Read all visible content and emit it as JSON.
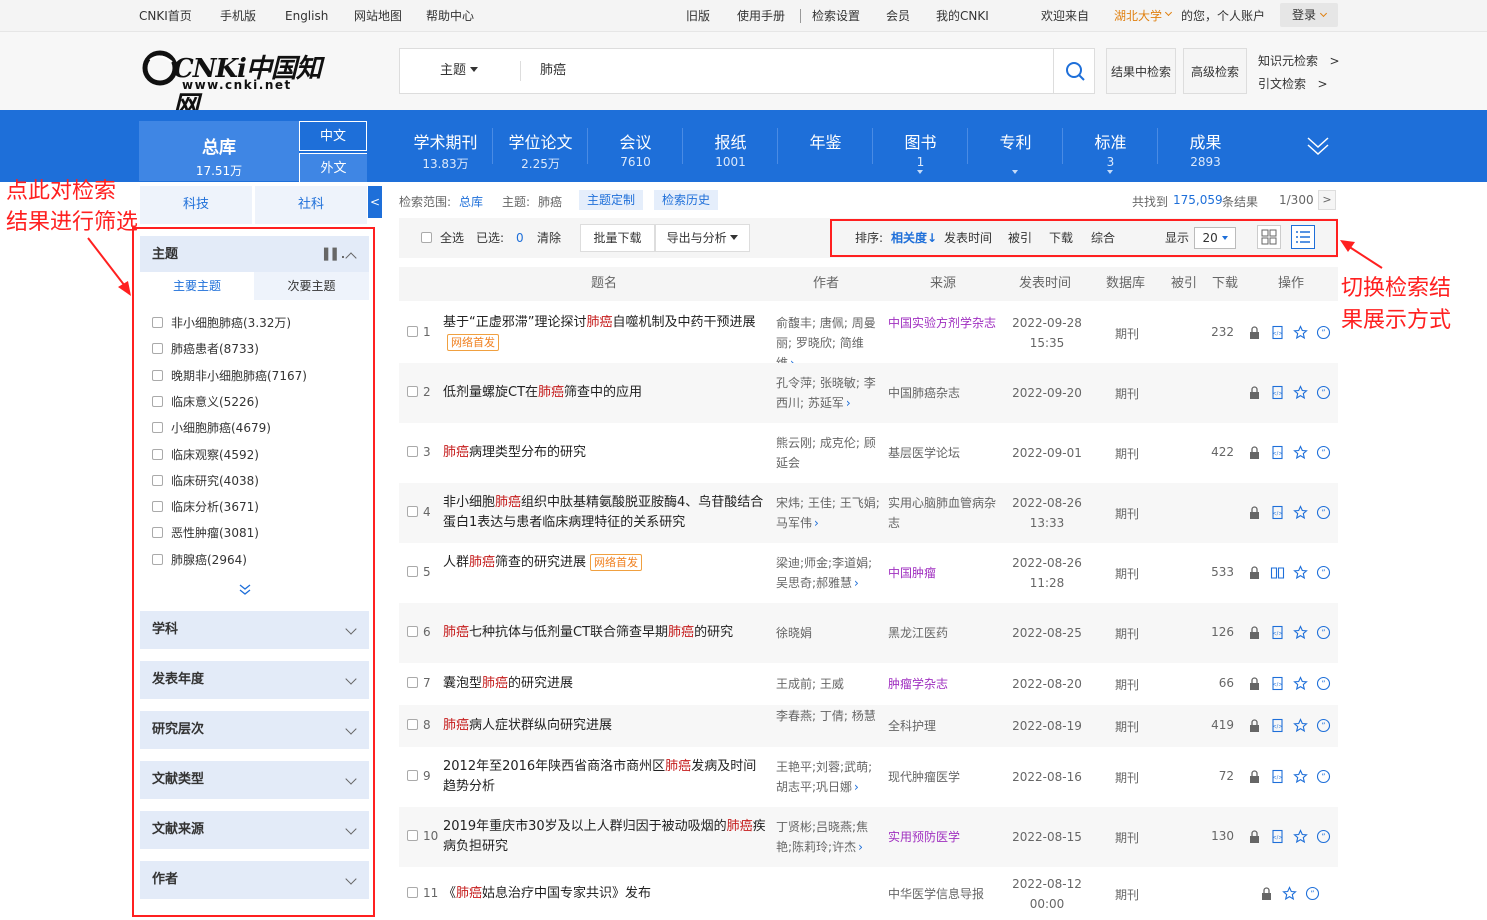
{
  "topbar": {
    "left_links": [
      "CNKI首页",
      "手机版",
      "English",
      "网站地图",
      "帮助中心"
    ],
    "right_links": [
      "旧版",
      "使用手册",
      "检索设置",
      "会员",
      "我的CNKI"
    ],
    "welcome": "欢迎来自",
    "institution": "湖北大学",
    "greeting": "的您，",
    "personal_account": "个人账户",
    "login": "登录"
  },
  "header": {
    "logo_text": "CNKi中国知网",
    "logo_url": "www.cnki.net",
    "search_type": "主题",
    "search_value": "肺癌",
    "btn_in_results": "结果中检索",
    "btn_advanced": "高级检索",
    "link_knowledge": "知识元检索",
    "link_citation": "引文检索"
  },
  "nav": {
    "zongku": {
      "label": "总库",
      "count": "17.51万"
    },
    "lang_cn": "中文",
    "lang_foreign": "外文",
    "items": [
      {
        "label": "学术期刊",
        "count": "13.83万",
        "caret": false
      },
      {
        "label": "学位论文",
        "count": "2.25万",
        "caret": false
      },
      {
        "label": "会议",
        "count": "7610",
        "caret": false
      },
      {
        "label": "报纸",
        "count": "1001",
        "caret": false
      },
      {
        "label": "年鉴",
        "count": "",
        "caret": false
      },
      {
        "label": "图书",
        "count": "1",
        "caret": true
      },
      {
        "label": "专利",
        "count": "",
        "caret": true
      },
      {
        "label": "标准",
        "count": "3",
        "caret": true
      },
      {
        "label": "成果",
        "count": "2893",
        "caret": false
      }
    ]
  },
  "sidebar": {
    "tabs": [
      "科技",
      "社科"
    ],
    "topic_panel": {
      "title": "主题",
      "subtabs": [
        "主要主题",
        "次要主题"
      ],
      "items": [
        "非小细胞肺癌(3.32万)",
        "肺癌患者(8733)",
        "晚期非小细胞肺癌(7167)",
        "临床意义(5226)",
        "小细胞肺癌(4679)",
        "临床观察(4592)",
        "临床研究(4038)",
        "临床分析(3671)",
        "恶性肿瘤(3081)",
        "肺腺癌(2964)"
      ]
    },
    "panels": [
      "学科",
      "发表年度",
      "研究层次",
      "文献类型",
      "文献来源",
      "作者"
    ]
  },
  "results": {
    "scope_label": "检索范围:",
    "scope_value": "总库",
    "topic_label": "主题:",
    "topic_value": "肺癌",
    "btn_customize": "主题定制",
    "btn_history": "检索历史",
    "found_prefix": "共找到",
    "found_count": "175,059",
    "found_suffix": "条结果",
    "pagination": "1/300",
    "toolbar": {
      "select_all": "全选",
      "selected_label": "已选:",
      "selected_count": "0",
      "clear": "清除",
      "batch_download": "批量下载",
      "export": "导出与分析",
      "sort_label": "排序:",
      "sort_relevance": "相关度",
      "sort_date": "发表时间",
      "sort_cited": "被引",
      "sort_download": "下载",
      "sort_composite": "综合",
      "display_label": "显示",
      "display_value": "20"
    },
    "columns": [
      "题名",
      "作者",
      "来源",
      "发表时间",
      "数据库",
      "被引",
      "下载",
      "操作"
    ],
    "rows": [
      {
        "num": "1",
        "pre": "基于“正虚邪滞”理论探讨",
        "hl": "肺癌",
        "post": "自噬机制及中药干预进展",
        "hl2": "",
        "post2": "",
        "first": "网络首发",
        "author": "俞馥丰; 唐佩; 周曼丽; 罗晓欣; 简维维",
        "src": "中国实验方剂学杂志",
        "purple": true,
        "date": "2022-09-28",
        "time": "15:35",
        "db": "期刊",
        "dl": "232",
        "read": false
      },
      {
        "num": "2",
        "pre": "低剂量螺旋CT在",
        "hl": "肺癌",
        "post": "筛查中的应用",
        "hl2": "",
        "post2": "",
        "first": "",
        "author": "孔令萍; 张晓敏; 李西川; 苏延军",
        "src": "中国肺癌杂志",
        "purple": false,
        "date": "2022-09-20",
        "time": "",
        "db": "期刊",
        "dl": "",
        "read": false
      },
      {
        "num": "3",
        "pre": "",
        "hl": "肺癌",
        "post": "病理类型分布的研究",
        "hl2": "",
        "post2": "",
        "first": "",
        "author": "熊云刚; 成克伦; 顾延会",
        "src": "基层医学论坛",
        "purple": false,
        "date": "2022-09-01",
        "time": "",
        "db": "期刊",
        "dl": "422",
        "read": false
      },
      {
        "num": "4",
        "pre": "非小细胞",
        "hl": "肺癌",
        "post": "组织中肽基精氨酸脱亚胺酶4、鸟苷酸结合蛋白1表达与患者临床病理特征的关系研究",
        "hl2": "",
        "post2": "",
        "first": "",
        "author": "宋炜; 王佳; 王飞娟; 马军伟",
        "src": "实用心脑肺血管病杂志",
        "purple": false,
        "date": "2022-08-26",
        "time": "13:33",
        "db": "期刊",
        "dl": "",
        "read": false
      },
      {
        "num": "5",
        "pre": "人群",
        "hl": "肺癌",
        "post": "筛查的研究进展",
        "hl2": "",
        "post2": "",
        "first": "网络首发",
        "author": "梁迪;师金;李道娟;吴思奇;郝雅慧",
        "src": "中国肿瘤",
        "purple": true,
        "date": "2022-08-26",
        "time": "11:28",
        "db": "期刊",
        "dl": "533",
        "read": true
      },
      {
        "num": "6",
        "pre": "",
        "hl": "肺癌",
        "post": "七种抗体与低剂量CT联合筛查早期",
        "hl2": "肺癌",
        "post2": "的研究",
        "first": "",
        "author": "徐晓娟",
        "src": "黑龙江医药",
        "purple": false,
        "date": "2022-08-25",
        "time": "",
        "db": "期刊",
        "dl": "126",
        "read": false
      },
      {
        "num": "7",
        "pre": "囊泡型",
        "hl": "肺癌",
        "post": "的研究进展",
        "hl2": "",
        "post2": "",
        "first": "",
        "author": "王成前; 王威",
        "src": "肿瘤学杂志",
        "purple": true,
        "date": "2022-08-20",
        "time": "",
        "db": "期刊",
        "dl": "66",
        "read": false
      },
      {
        "num": "8",
        "pre": "",
        "hl": "肺癌",
        "post": "病人症状群纵向研究进展",
        "hl2": "",
        "post2": "",
        "first": "",
        "author": "李春燕; 丁倩; 杨慧",
        "src": "全科护理",
        "purple": false,
        "date": "2022-08-19",
        "time": "",
        "db": "期刊",
        "dl": "419",
        "read": false
      },
      {
        "num": "9",
        "pre": "2012年至2016年陕西省商洛市商州区",
        "hl": "肺癌",
        "post": "发病及时间趋势分析",
        "hl2": "",
        "post2": "",
        "first": "",
        "author": "王艳平;刘蓉;武萌;胡志平;巩日娜",
        "src": "现代肿瘤医学",
        "purple": false,
        "date": "2022-08-16",
        "time": "",
        "db": "期刊",
        "dl": "72",
        "read": false
      },
      {
        "num": "10",
        "pre": "2019年重庆市30岁及以上人群归因于被动吸烟的",
        "hl": "肺癌",
        "post": "疾病负担研究",
        "hl2": "",
        "post2": "",
        "first": "",
        "author": "丁贤彬;吕晓燕;焦艳;陈莉玲;许杰",
        "src": "实用预防医学",
        "purple": true,
        "date": "2022-08-15",
        "time": "",
        "db": "期刊",
        "dl": "130",
        "read": false
      },
      {
        "num": "11",
        "pre": "《",
        "hl": "肺癌",
        "post": "姑息治疗中国专家共识》发布",
        "hl2": "",
        "post2": "",
        "first": "",
        "author": "",
        "src": "中华医学信息导报",
        "purple": false,
        "date": "2022-08-12",
        "time": "00:00",
        "db": "期刊",
        "dl": "",
        "read": false
      }
    ]
  },
  "annotations": {
    "left_line1": "点此对检索",
    "left_line2": "结果进行筛选",
    "right_line1": "切换检索结",
    "right_line2": "果展示方式"
  }
}
